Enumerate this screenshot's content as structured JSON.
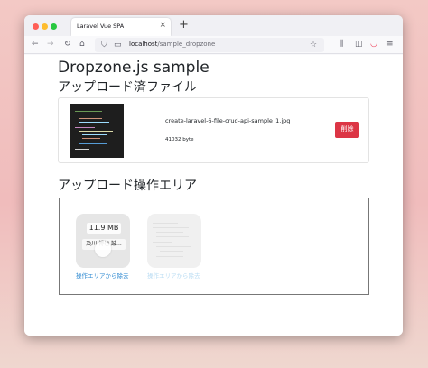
{
  "browser": {
    "tab_title": "Laravel Vue SPA",
    "tab_close": "×",
    "new_tab": "+",
    "url_host": "localhost",
    "url_path": "/sample_dropzone",
    "icons": {
      "back": "←",
      "forward": "→",
      "reload": "↻",
      "home": "⌂",
      "shield": "⛉",
      "page": "▭",
      "bookmark": "☆",
      "library": "⫼",
      "sidebar": "◫",
      "pocket": "◡",
      "menu": "≡"
    }
  },
  "page": {
    "title": "Dropzone.js sample",
    "uploaded_heading": "アップロード済ファイル",
    "uploaded_file": {
      "name": "create-laravel-6-file-crud-api-sample_1.jpg",
      "size": "41032 byte",
      "delete_label": "削除"
    },
    "area_heading": "アップロード操作エリア",
    "previews": [
      {
        "size": "11.9 MB",
        "name": "及川 博也 誠...",
        "remove_label": "操作エリアから除去"
      },
      {
        "remove_label": "操作エリアから除去"
      }
    ]
  },
  "colors": {
    "danger": "#dc3545",
    "link": "#2a87d0",
    "accent_red": "#ff5f57",
    "accent_yellow": "#febc2e",
    "accent_green": "#28c840"
  }
}
